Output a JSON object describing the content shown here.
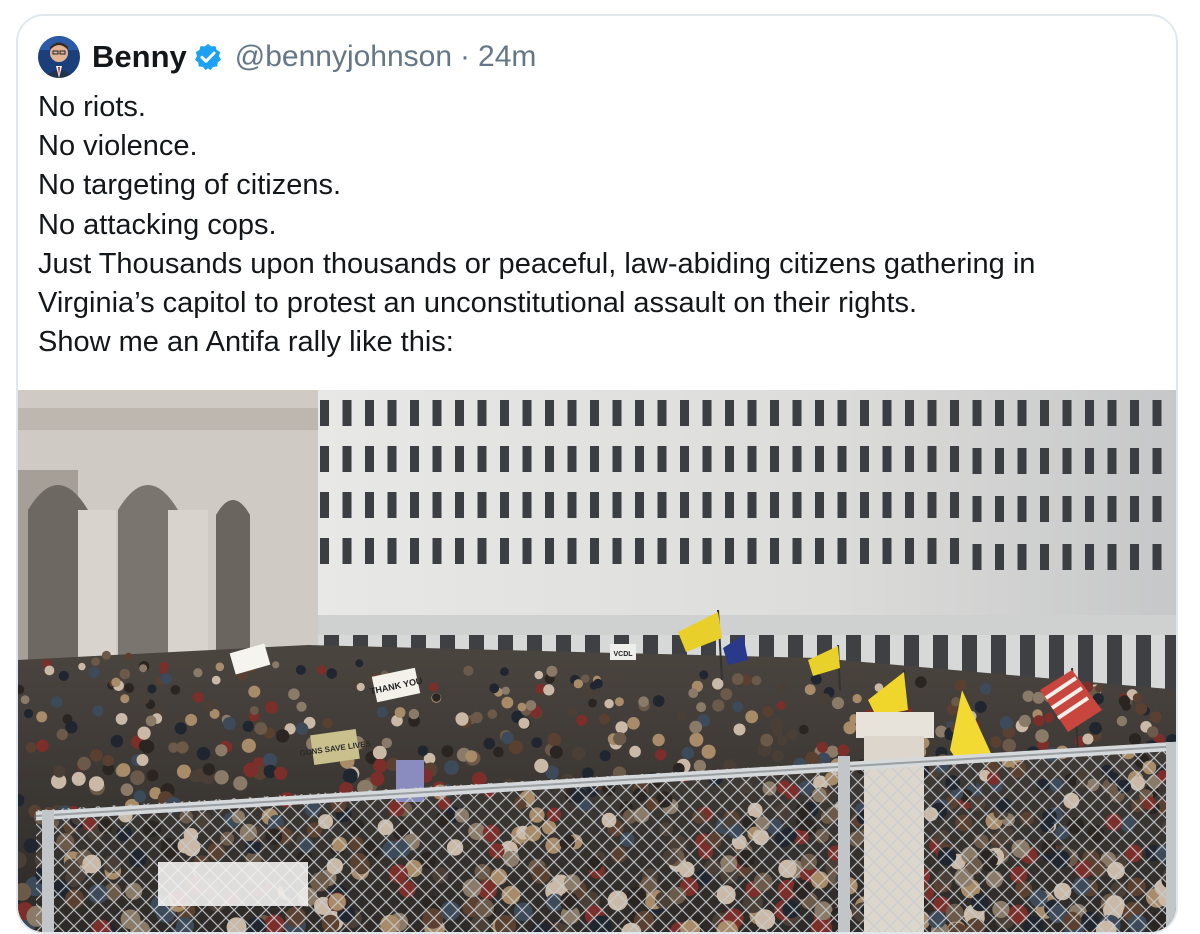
{
  "tweet": {
    "author": {
      "display_name": "Benny",
      "handle": "@bennyjohnson",
      "verified": true,
      "avatar_icon": "avatar-icon",
      "verified_icon": "verified-badge-icon"
    },
    "separator": "·",
    "timestamp": "24m",
    "lines": [
      "No riots.",
      "No violence.",
      "No targeting of citizens.",
      "No attacking cops.",
      "Just Thousands upon thousands or peaceful, law-abiding citizens gathering in",
      "Virginia’s capitol to protest an unconstitutional assault on their rights.",
      "Show me an Antifa rally like this:"
    ]
  },
  "media": {
    "type": "video",
    "protest_signs": [
      "THANK YOU",
      "VCDL",
      "GUNS SAVE LIVES"
    ]
  },
  "colors": {
    "text": "#14171a",
    "secondary": "#657786",
    "verified": "#1da1f2",
    "border": "#e1e8ed"
  }
}
